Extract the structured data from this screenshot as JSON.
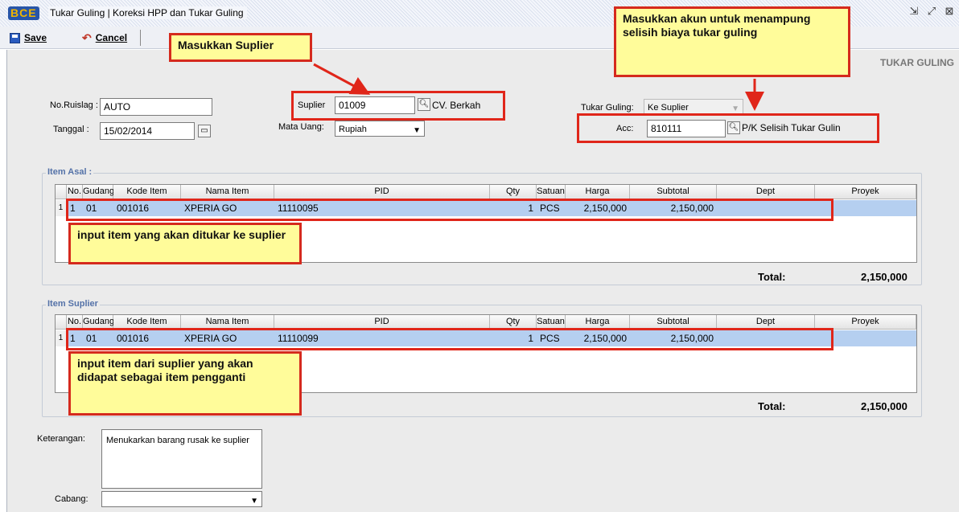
{
  "window": {
    "logo": "BCE",
    "title": "Tukar Guling | Koreksi HPP dan Tukar Guling",
    "buttons": [
      "restore-icon",
      "maximize-icon",
      "close-icon"
    ]
  },
  "toolbar": {
    "save_label": "Save",
    "cancel_label": "Cancel"
  },
  "form": {
    "heading": "TUKAR GULING",
    "no_ruislag_label": "No.Ruislag :",
    "no_ruislag_value": "AUTO",
    "tanggal_label": "Tanggal :",
    "tanggal_value": "15/02/2014",
    "suplier_label": "Suplier",
    "suplier_code": "01009",
    "suplier_name": "CV. Berkah",
    "mata_uang_label": "Mata Uang:",
    "mata_uang_value": "Rupiah",
    "tukar_guling_label": "Tukar Guling:",
    "tukar_guling_value": "Ke Suplier",
    "acc_label": "Acc:",
    "acc_code": "810111",
    "acc_name": "P/K Selisih Tukar Gulin",
    "keterangan_label": "Keterangan:",
    "keterangan_value": "Menukarkan barang rusak ke suplier",
    "cabang_label": "Cabang:",
    "cabang_value": ""
  },
  "columns": [
    "No.",
    "Gudang",
    "Kode Item",
    "Nama Item",
    "PID",
    "Qty",
    "Satuan",
    "Harga",
    "Subtotal",
    "Dept",
    "Proyek"
  ],
  "item_asal": {
    "title": "Item Asal :",
    "rows": [
      {
        "indicator": "1",
        "no": "1",
        "gudang": "01",
        "kode": "001016",
        "nama": "XPERIA GO",
        "pid": "11110095",
        "qty": "1",
        "satuan": "PCS",
        "harga": "2,150,000",
        "subtotal": "2,150,000",
        "dept": "",
        "proyek": ""
      }
    ],
    "total_label": "Total:",
    "total_value": "2,150,000"
  },
  "item_suplier": {
    "title": "Item Suplier",
    "rows": [
      {
        "indicator": "1",
        "no": "1",
        "gudang": "01",
        "kode": "001016",
        "nama": "XPERIA GO",
        "pid": "11110099",
        "qty": "1",
        "satuan": "PCS",
        "harga": "2,150,000",
        "subtotal": "2,150,000",
        "dept": "",
        "proyek": ""
      }
    ],
    "total_label": "Total:",
    "total_value": "2,150,000"
  },
  "annotations": {
    "suplier": "Masukkan Suplier",
    "akun": "Masukkan akun untuk menampung selisih biaya tukar guling",
    "item_asal": "input item yang akan ditukar ke suplier",
    "item_suplier": "input item dari suplier yang akan didapat sebagai item pengganti"
  },
  "colors": {
    "callout_bg": "#fffc9a",
    "callout_border": "#d52a1d",
    "selected_row": "#b5cff0",
    "group_title": "#5472a8"
  }
}
